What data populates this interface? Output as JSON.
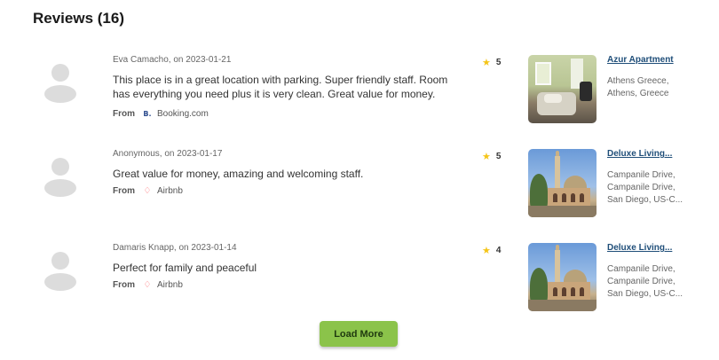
{
  "page": {
    "title": "Reviews (16)"
  },
  "reviews": [
    {
      "author_line": "Eva Camacho, on 2023-01-21",
      "text": "This place is in a great location with parking. Super friendly staff. Room has everything you need plus it is very clean. Great value for money.",
      "from_label": "From",
      "source_icon": "booking-icon",
      "source_glyph": "B.",
      "source": "Booking.com",
      "rating": "5",
      "property": {
        "name": "Azur Apartment",
        "address": [
          "Athens Greece,",
          "Athens, Greece"
        ],
        "image": "apartment-room-photo"
      }
    },
    {
      "author_line": "Anonymous, on 2023-01-17",
      "text": "Great value for money, amazing and welcoming staff.",
      "from_label": "From",
      "source_icon": "airbnb-icon",
      "source_glyph": "♢",
      "source": "Airbnb",
      "rating": "5",
      "property": {
        "name": "Deluxe Living...",
        "address": [
          "Campanile Drive,",
          "Campanile Drive,",
          "San Diego, US-C..."
        ],
        "image": "mosque-building-photo"
      }
    },
    {
      "author_line": "Damaris Knapp, on 2023-01-14",
      "text": "Perfect for family and peaceful",
      "from_label": "From",
      "source_icon": "airbnb-icon",
      "source_glyph": "♢",
      "source": "Airbnb",
      "rating": "4",
      "property": {
        "name": "Deluxe Living...",
        "address": [
          "Campanile Drive,",
          "Campanile Drive,",
          "San Diego, US-C..."
        ],
        "image": "mosque-building-photo"
      }
    }
  ],
  "actions": {
    "load_more": "Load More"
  },
  "colors": {
    "accent_button": "#8bc34a",
    "star": "#f5c518",
    "link": "#1f4e79",
    "airbnb": "#ff5a5f",
    "booking": "#2a4a8c"
  }
}
